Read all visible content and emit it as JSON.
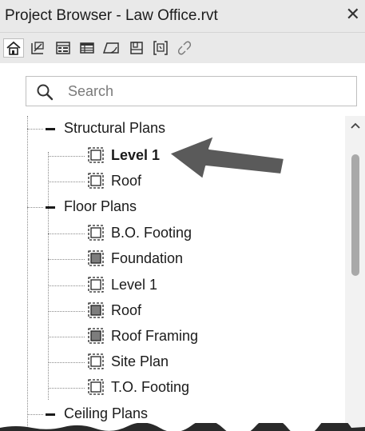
{
  "window": {
    "title": "Project Browser - Law Office.rvt",
    "close_glyph": "✕"
  },
  "toolbar": {
    "buttons": [
      {
        "icon": "project-browser-home-icon",
        "active": true
      },
      {
        "icon": "view-3d-icon",
        "active": false
      },
      {
        "icon": "schedule-icon",
        "active": false
      },
      {
        "icon": "table-icon",
        "active": false
      },
      {
        "icon": "sheet-icon",
        "active": false
      },
      {
        "icon": "family-icon",
        "active": false
      },
      {
        "icon": "group-icon",
        "active": false
      },
      {
        "icon": "link-icon",
        "active": false
      }
    ]
  },
  "search": {
    "placeholder": "Search",
    "value": ""
  },
  "tree": {
    "structural_plans": {
      "label": "Structural Plans",
      "items": [
        {
          "label": "Level 1",
          "bold": true,
          "filled": false
        },
        {
          "label": "Roof",
          "bold": false,
          "filled": false
        }
      ]
    },
    "floor_plans": {
      "label": "Floor Plans",
      "items": [
        {
          "label": "B.O. Footing",
          "filled": false
        },
        {
          "label": "Foundation",
          "filled": true
        },
        {
          "label": "Level 1",
          "filled": false
        },
        {
          "label": "Roof",
          "filled": true
        },
        {
          "label": "Roof Framing",
          "filled": true
        },
        {
          "label": "Site Plan",
          "filled": false
        },
        {
          "label": "T.O. Footing",
          "filled": false
        }
      ]
    },
    "ceiling_plans": {
      "label": "Ceiling Plans"
    }
  },
  "colors": {
    "chrome": "#e9e9e9",
    "view_icon_filled": "#7d7d7d",
    "arrow": "#5a5a5a"
  }
}
